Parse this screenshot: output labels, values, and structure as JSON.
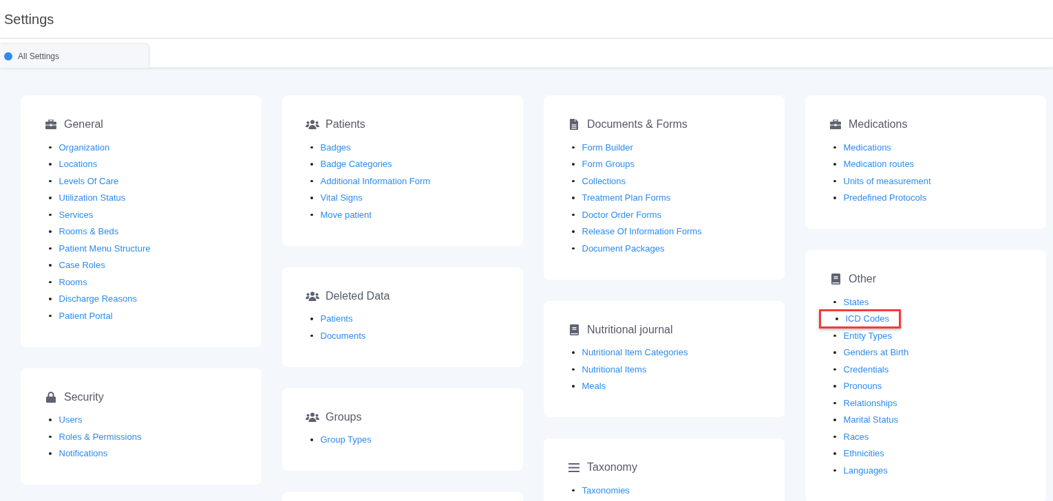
{
  "page_title": "Settings",
  "tabs": [
    {
      "label": "All Settings",
      "selected": true
    }
  ],
  "columns": [
    {
      "sections": [
        {
          "kind": "section",
          "title": "General",
          "items": [
            {
              "label": "Organization",
              "highlighted": false
            },
            {
              "label": "Locations",
              "highlighted": false
            },
            {
              "label": "Levels Of Care",
              "highlighted": false
            },
            {
              "label": "Utilization Status",
              "highlighted": false
            },
            {
              "label": "Services",
              "highlighted": false
            },
            {
              "label": "Rooms & Beds",
              "highlighted": false
            },
            {
              "label": "Patient Menu Structure",
              "highlighted": false
            },
            {
              "label": "Case Roles",
              "highlighted": false
            },
            {
              "label": "Rooms",
              "highlighted": false
            },
            {
              "label": "Discharge Reasons",
              "highlighted": false
            },
            {
              "label": "Patient Portal",
              "highlighted": false
            }
          ]
        },
        {
          "kind": "section",
          "title": "Security",
          "items": [
            {
              "label": "Users",
              "highlighted": false
            },
            {
              "label": "Roles & Permissions",
              "highlighted": false
            },
            {
              "label": "Notifications",
              "highlighted": false
            }
          ]
        }
      ]
    },
    {
      "sections": [
        {
          "kind": "section",
          "title": "Patients",
          "items": [
            {
              "label": "Badges",
              "highlighted": false
            },
            {
              "label": "Badge Categories",
              "highlighted": false
            },
            {
              "label": "Additional Information Form",
              "highlighted": false
            },
            {
              "label": "Vital Signs",
              "highlighted": false
            },
            {
              "label": "Move patient",
              "highlighted": false
            }
          ]
        },
        {
          "kind": "section",
          "title": "Deleted Data",
          "items": [
            {
              "label": "Patients",
              "highlighted": false
            },
            {
              "label": "Documents",
              "highlighted": false
            }
          ]
        },
        {
          "kind": "section",
          "title": "Groups",
          "items": [
            {
              "label": "Group Types",
              "highlighted": false
            }
          ]
        },
        {
          "kind": "blank"
        }
      ]
    },
    {
      "sections": [
        {
          "kind": "section",
          "title": "Documents & Forms",
          "items": [
            {
              "label": "Form Builder",
              "highlighted": false
            },
            {
              "label": "Form Groups",
              "highlighted": false
            },
            {
              "label": "Collections",
              "highlighted": false
            },
            {
              "label": "Treatment Plan Forms",
              "highlighted": false
            },
            {
              "label": "Doctor Order Forms",
              "highlighted": false
            },
            {
              "label": "Release Of Information Forms",
              "highlighted": false
            },
            {
              "label": "Document Packages",
              "highlighted": false
            }
          ]
        },
        {
          "kind": "section",
          "title": "Nutritional journal",
          "items": [
            {
              "label": "Nutritional Item Categories",
              "highlighted": false
            },
            {
              "label": "Nutritional Items",
              "highlighted": false
            },
            {
              "label": "Meals",
              "highlighted": false
            }
          ]
        },
        {
          "kind": "section",
          "title": "Taxonomy",
          "items": [
            {
              "label": "Taxonomies",
              "highlighted": false
            }
          ]
        }
      ]
    },
    {
      "sections": [
        {
          "kind": "section",
          "title": "Medications",
          "items": [
            {
              "label": "Medications",
              "highlighted": false
            },
            {
              "label": "Medication routes",
              "highlighted": false
            },
            {
              "label": "Units of measurement",
              "highlighted": false
            },
            {
              "label": "Predefined Protocols",
              "highlighted": false
            }
          ]
        },
        {
          "kind": "section",
          "title": "Other",
          "items": [
            {
              "label": "States",
              "highlighted": false
            },
            {
              "label": "ICD Codes",
              "highlighted": true
            },
            {
              "label": "Entity Types",
              "highlighted": false
            },
            {
              "label": "Genders at Birth",
              "highlighted": false
            },
            {
              "label": "Credentials",
              "highlighted": false
            },
            {
              "label": "Pronouns",
              "highlighted": false
            },
            {
              "label": "Relationships",
              "highlighted": false
            },
            {
              "label": "Marital Status",
              "highlighted": false
            },
            {
              "label": "Races",
              "highlighted": false
            },
            {
              "label": "Ethnicities",
              "highlighted": false
            },
            {
              "label": "Languages",
              "highlighted": false
            }
          ]
        }
      ]
    }
  ]
}
